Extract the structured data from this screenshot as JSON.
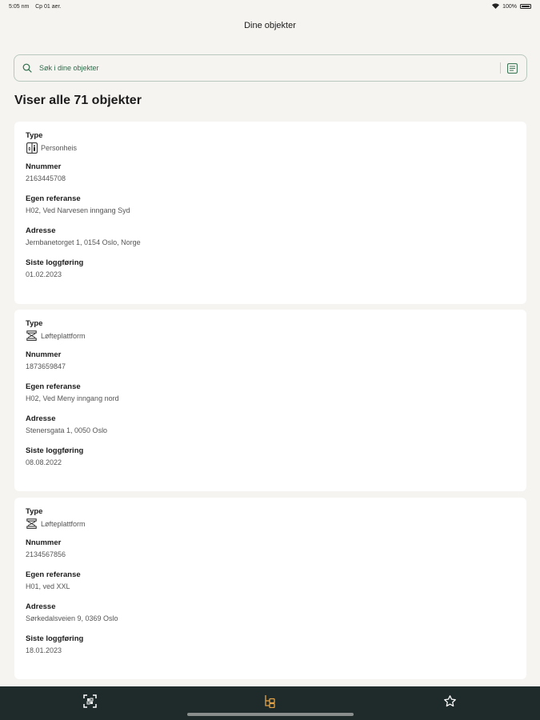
{
  "status_bar": {
    "time": "5:05 nm",
    "date": "Cp 01 aer.",
    "battery_text": "100%"
  },
  "nav": {
    "title": "Dine objekter"
  },
  "search": {
    "placeholder": "Søk i dine objekter",
    "value": ""
  },
  "heading": "Viser alle 71 objekter",
  "labels": {
    "type": "Type",
    "number": "Nnummer",
    "ref": "Egen referanse",
    "address": "Adresse",
    "last_log": "Siste loggføring"
  },
  "objects": [
    {
      "type": "Personheis",
      "type_icon": "elevator-icon",
      "number": "2163445708",
      "ref": "H02, Ved Narvesen inngang Syd",
      "address": "Jernbanetorget 1, 0154 Oslo, Norge",
      "last_log": "01.02.2023"
    },
    {
      "type": "Løfteplattform",
      "type_icon": "lift-platform-icon",
      "number": "1873659847",
      "ref": "H02, Ved Meny inngang nord",
      "address": "Stenersgata 1, 0050 Oslo",
      "last_log": "08.08.2022"
    },
    {
      "type": "Løfteplattform",
      "type_icon": "lift-platform-icon",
      "number": "2134567856",
      "ref": "H01, ved XXL",
      "address": "Sørkedalsveien 9, 0369 Oslo",
      "last_log": "18.01.2023"
    }
  ],
  "tabs": [
    {
      "name": "scan-tab",
      "icon": "scan-icon",
      "active": false
    },
    {
      "name": "objects-tab",
      "icon": "tree-icon",
      "active": true
    },
    {
      "name": "favorites-tab",
      "icon": "star-icon",
      "active": false
    }
  ],
  "colors": {
    "background": "#f6f4f0",
    "accent": "#2d6b4a",
    "tab_bar": "#1f2b2a",
    "tab_active": "#e3a44a"
  }
}
